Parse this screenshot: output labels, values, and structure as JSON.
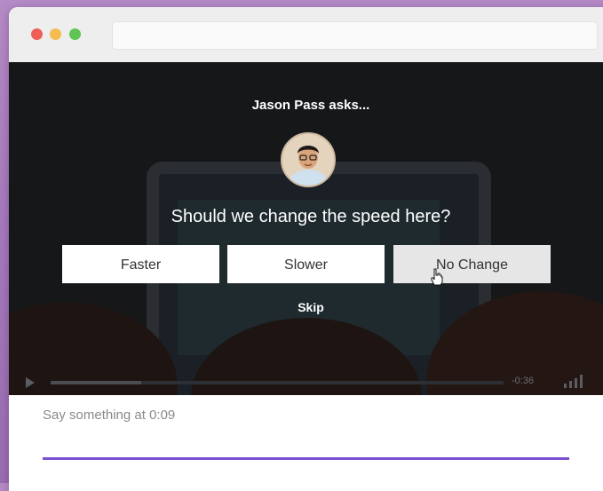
{
  "prompt": {
    "asker": "Jason Pass asks...",
    "question": "Should we change the speed here?",
    "choices": [
      "Faster",
      "Slower",
      "No Change"
    ],
    "skip_label": "Skip"
  },
  "player": {
    "time_remaining": "-0:36",
    "progress_fraction": 0.2
  },
  "comment": {
    "placeholder": "Say something at 0:09"
  },
  "colors": {
    "accent": "#7a4fd0",
    "video_bg": "#151719"
  }
}
